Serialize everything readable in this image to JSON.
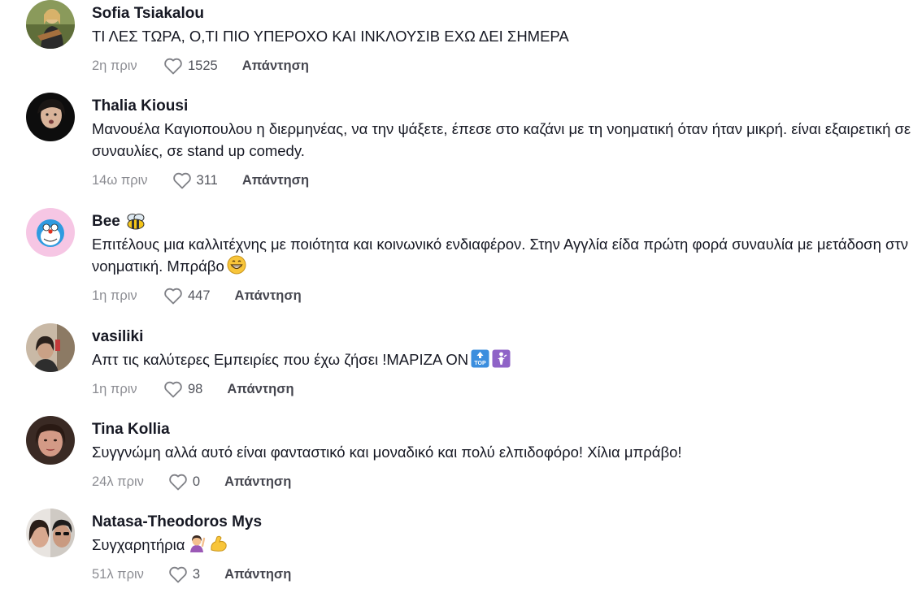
{
  "reply_label": "Απάντηση",
  "comments": [
    {
      "username": "Sofia Tsiakalou",
      "text": "ΤΙ ΛΕΣ ΤΩΡΑ, Ο,ΤΙ ΠΙΟ ΥΠΕΡΟΧΟ ΚΑΙ ΙΝΚΛΟΥΣΙΒ ΕΧΩ ΔΕΙ ΣΗΜΕΡΑ",
      "time": "2η πριν",
      "likes": "1525"
    },
    {
      "username": "Thalia Kiousi",
      "text": "Μανουέλα Καγιοπουλου η διερμηνέας, να την ψάξετε, έπεσε στο καζάνι με τη νοηματική όταν ήταν μικρή. είναι εξαιρετική σε συναυλίες, σε stand up comedy.",
      "time": "14ω πριν",
      "likes": "311"
    },
    {
      "username": "Bee",
      "username_emoji": "bee-icon",
      "text": "Επιτέλους μια καλλιτέχνης με ποιότητα και κοινωνικό ενδιαφέρον. Στην Αγγλία είδα πρώτη φορά συναυλία με μετάδοση στν νοηματική. Μπράβο",
      "text_emoji": "grinning-face-icon",
      "time": "1η πριν",
      "likes": "447"
    },
    {
      "username": "vasiliki",
      "text": "Απτ τις καλύτερες Εμπειρίες που έχω ζήσει !ΜΑΡΙΖΑ ΟΝ",
      "text_emoji": [
        "top-arrow-icon",
        "woman-tipping-hand-icon"
      ],
      "time": "1η πριν",
      "likes": "98"
    },
    {
      "username": "Tina Kollia",
      "text": "Συγγνώμη αλλά αυτό είναι φανταστικό και μοναδικό και πολύ ελπιδοφόρο! Χίλια μπράβο!",
      "time": "24λ πριν",
      "likes": "0"
    },
    {
      "username": "Natasa-Theodoros Mys",
      "text": "Συγχαρητήρια",
      "text_emoji": [
        "woman-raising-hand-icon",
        "flexed-biceps-icon"
      ],
      "time": "51λ πριν",
      "likes": "3"
    }
  ]
}
